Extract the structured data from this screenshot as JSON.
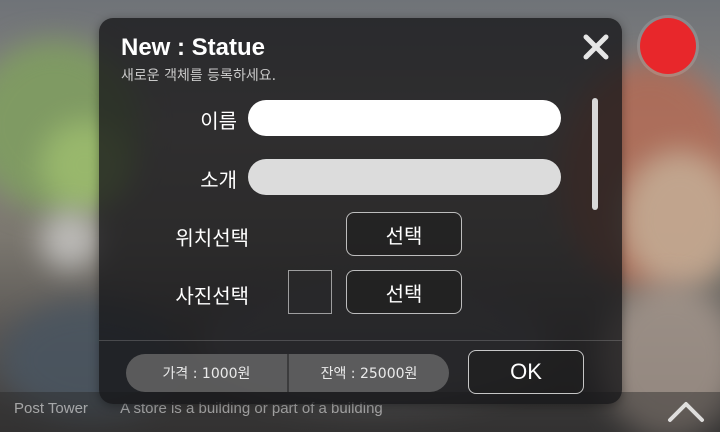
{
  "background": {
    "tooltip_text": "Post Tower",
    "tooltip_subtext": "A store is a building or part of a building"
  },
  "dialog": {
    "title": "New : Statue",
    "subtitle": "새로운 객체를 등록하세요.",
    "fields": {
      "name_label": "이름",
      "name_value": "",
      "intro_label": "소개",
      "intro_value": "",
      "location_label": "위치선택",
      "location_button": "선택",
      "photo_label": "사진선택",
      "photo_button": "선택"
    },
    "footer": {
      "price": "가격 : 1000원",
      "balance": "잔액 : 25000원",
      "ok_label": "OK"
    }
  },
  "colors": {
    "record": "#e8272b",
    "dialog_bg": "#161618"
  },
  "icons": [
    "close-icon",
    "chevron-up-icon",
    "record-button"
  ]
}
